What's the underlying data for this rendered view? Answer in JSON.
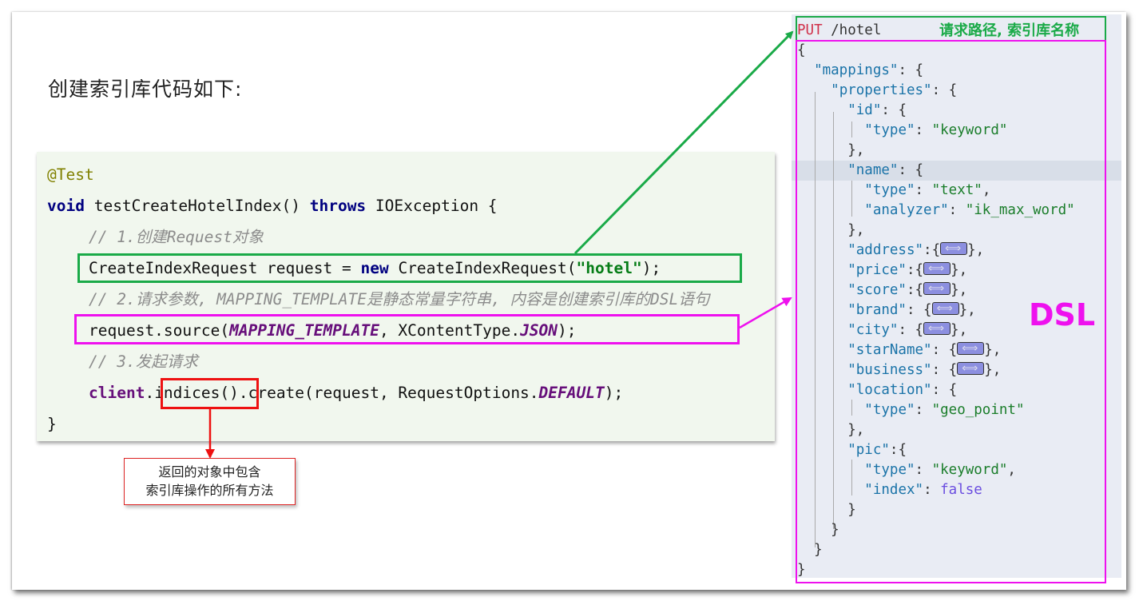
{
  "heading": "创建索引库代码如下:",
  "code": {
    "annotation": "@Test",
    "signature": {
      "kw_void": "void",
      "name": " testCreateHotelIndex() ",
      "kw_throws": "throws",
      "rest": " IOException {"
    },
    "comment1": "// 1.创建Request对象",
    "line1": {
      "a": "CreateIndexRequest request = ",
      "kw_new": "new",
      "b": " CreateIndexRequest(",
      "str": "\"hotel\"",
      "c": ");"
    },
    "comment2": "// 2.请求参数, MAPPING_TEMPLATE是静态常量字符串, 内容是创建索引库的DSL语句",
    "line2": {
      "a": "request.source(",
      "const": "MAPPING_TEMPLATE",
      "b": ", XContentType.",
      "const2": "JSON",
      "c": ");"
    },
    "comment3": "// 3.发起请求",
    "line3": {
      "field": "client",
      "a": ".indices().create(request, RequestOptions.",
      "const": "DEFAULT",
      "c": ");"
    },
    "close": "}"
  },
  "note": {
    "line1": "返回的对象中包含",
    "line2": "索引库操作的所有方法"
  },
  "dsl": {
    "method": "PUT",
    "path": " /hotel",
    "path_label": "请求路径, 索引库名称",
    "label": "DSL",
    "rows": {
      "open": "{",
      "mappings": "\"mappings\"",
      "properties": "\"properties\"",
      "id": "\"id\"",
      "type": "\"type\"",
      "keyword": "\"keyword\"",
      "name": "\"name\"",
      "text": "\"text\"",
      "analyzer": "\"analyzer\"",
      "ik": "\"ik_max_word\"",
      "address": "\"address\"",
      "price": "\"price\"",
      "score": "\"score\"",
      "brand": "\"brand\"",
      "city": "\"city\"",
      "starName": "\"starName\"",
      "business": "\"business\"",
      "location": "\"location\"",
      "geo": "\"geo_point\"",
      "pic": "\"pic\"",
      "index": "\"index\"",
      "false": "false"
    }
  },
  "colors": {
    "green": "#1aaa48",
    "magenta": "#ee11ee",
    "red": "#ee1111"
  }
}
